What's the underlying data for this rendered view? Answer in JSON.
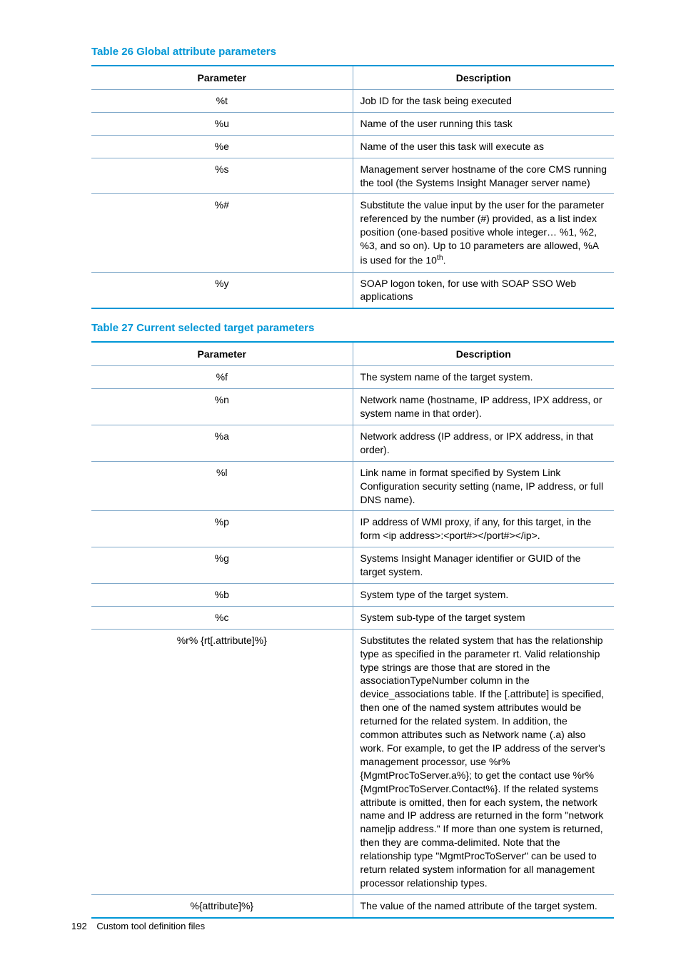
{
  "tables": [
    {
      "caption": "Table 26 Global attribute parameters",
      "columns": [
        "Parameter",
        "Description"
      ],
      "rows": [
        {
          "param": "%t",
          "desc": "Job ID for the task being executed"
        },
        {
          "param": "%u",
          "desc": "Name of the user running this task"
        },
        {
          "param": "%e",
          "desc": "Name of the user this task will execute as"
        },
        {
          "param": "%s",
          "desc": "Management server hostname of the core CMS running the tool (the Systems Insight Manager server name)"
        },
        {
          "param": "%#",
          "desc_html": "Substitute the value input by the user for the parameter referenced by the number (#) provided, as a list index position (one-based positive whole integer… %1, %2, %3, and so on). Up to 10 parameters are allowed, %A is used for the 10<sup>th</sup>."
        },
        {
          "param": "%y",
          "desc": "SOAP logon token, for use with SOAP SSO Web applications"
        }
      ]
    },
    {
      "caption": "Table 27 Current selected target parameters",
      "columns": [
        "Parameter",
        "Description"
      ],
      "rows": [
        {
          "param": "%f",
          "desc": "The system name of the target system."
        },
        {
          "param": "%n",
          "desc": "Network name (hostname, IP address, IPX address, or system name in that order)."
        },
        {
          "param": "%a",
          "desc": "Network address (IP address, or IPX address, in that order)."
        },
        {
          "param": "%l",
          "desc": "Link name in format specified by System Link Configuration security setting (name, IP address, or full DNS name)."
        },
        {
          "param": "%p",
          "desc": "IP address of WMI proxy, if any, for this target, in the form <ip address>:<port#></port#></ip>."
        },
        {
          "param": "%g",
          "desc": "Systems Insight Manager identifier or GUID of the target system."
        },
        {
          "param": "%b",
          "desc": "System type of the target system."
        },
        {
          "param": "%c",
          "desc": "System sub-type of the target system"
        },
        {
          "param": "%r% {rt[.attribute]%}",
          "desc": "Substitutes the related system that has the relationship type as specified in the parameter rt. Valid relationship type strings are those that are stored in the associationTypeNumber column in the device_associations table. If the [.attribute] is specified, then one of the named system attributes would be returned for the related system. In addition, the common attributes such as Network name (.a) also work. For example, to get the IP address of the server's management processor, use %r%{MgmtProcToServer.a%}; to get the contact use %r%{MgmtProcToServer.Contact%}. If the related systems attribute is omitted, then for each system, the network name and IP address are returned in the form \"network name|ip address.\" If more than one system is returned, then they are comma-delimited. Note that the relationship type \"MgmtProcToServer\" can be used to return related system information for all management processor relationship types."
        },
        {
          "param": "%{attribute]%}",
          "desc": "The value of the named attribute of the target system."
        }
      ]
    }
  ],
  "footer": {
    "page": "192",
    "title": "Custom tool definition files"
  }
}
